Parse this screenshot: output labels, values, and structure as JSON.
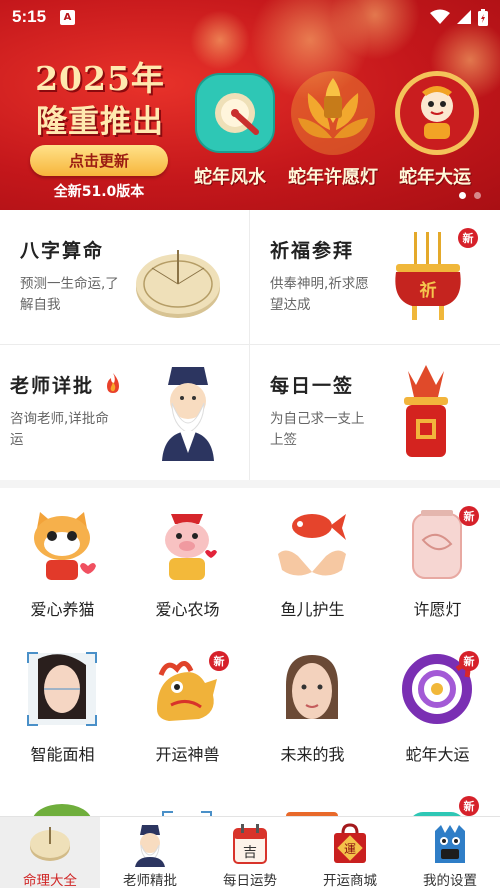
{
  "status_bar": {
    "time": "5:15",
    "notification_glyph": "A"
  },
  "banner": {
    "year_text": "2025年",
    "headline": "隆重推出",
    "cta_label": "点击更新",
    "version_text": "全新51.0版本",
    "features": [
      {
        "label": "蛇年风水",
        "icon": "luopan-icon"
      },
      {
        "label": "蛇年许愿灯",
        "icon": "lotus-lantern-icon"
      },
      {
        "label": "蛇年大运",
        "icon": "snake-mascot-icon"
      }
    ],
    "carousel": {
      "total": 2,
      "active": 1
    }
  },
  "cards": [
    {
      "title": "八字算命",
      "desc": "预测一生命运,了解自我",
      "new": false
    },
    {
      "title": "祈福参拜",
      "desc": "供奉神明,祈求愿望达成",
      "new": true,
      "new_label": "新"
    },
    {
      "title": "老师详批",
      "desc": "咨询老师,详批命运",
      "new": false
    },
    {
      "title": "每日一签",
      "desc": "为自己求一支上上签",
      "new": false
    }
  ],
  "censer_char": "祈",
  "grid": [
    {
      "label": "爱心养猫",
      "new": false
    },
    {
      "label": "爱心农场",
      "new": false
    },
    {
      "label": "鱼儿护生",
      "new": false
    },
    {
      "label": "许愿灯",
      "new": true
    },
    {
      "label": "智能面相",
      "new": false
    },
    {
      "label": "开运神兽",
      "new": true
    },
    {
      "label": "未来的我",
      "new": false
    },
    {
      "label": "蛇年大运",
      "new": true
    }
  ],
  "new_badge": "新",
  "nav": {
    "tabs": [
      {
        "label": "命理大全",
        "active": true
      },
      {
        "label": "老师精批",
        "active": false
      },
      {
        "label": "每日运势",
        "active": false
      },
      {
        "label": "开运商城",
        "active": false
      },
      {
        "label": "我的设置",
        "active": false
      }
    ],
    "calendar_char": "吉",
    "shop_char": "運"
  },
  "colors": {
    "brand_red": "#c4171b",
    "active_tab": "#d02626",
    "badge": "#d6212a"
  }
}
